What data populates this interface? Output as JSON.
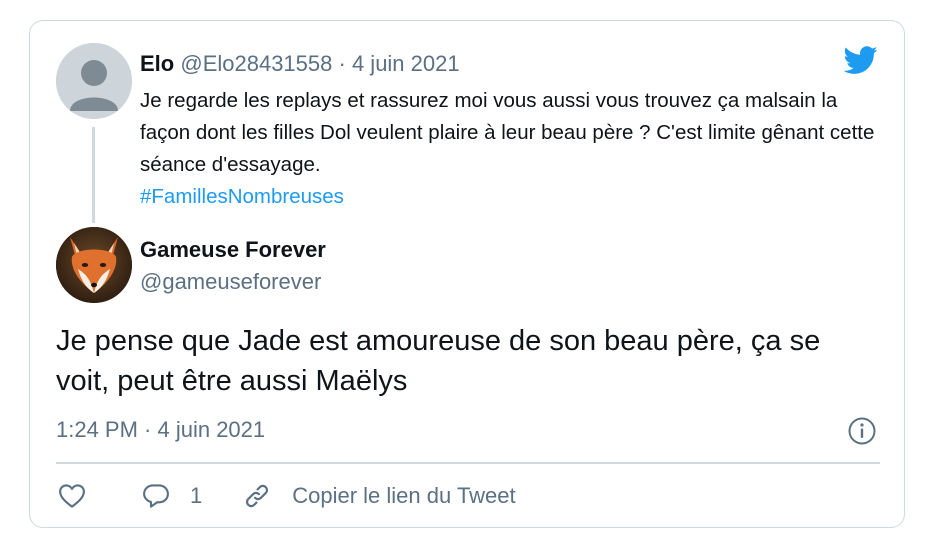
{
  "parent_tweet": {
    "author_name": "Elo",
    "author_handle": "@Elo28431558",
    "separator": "·",
    "date": "4 juin 2021",
    "text": "Je regarde les replays et rassurez moi vous aussi vous trouvez ça malsain la façon dont les filles Dol veulent plaire à leur beau père ? C'est limite gênant cette séance d'essayage.",
    "hashtag": "#FamillesNombreuses"
  },
  "main_tweet": {
    "author_name": "Gameuse Forever",
    "author_handle": "@gameuseforever",
    "text": "Je pense que Jade est amoureuse de son beau père, ça se voit, peut être aussi Maëlys",
    "timestamp": "1:24 PM · 4 juin 2021"
  },
  "actions": {
    "reply_count": "1",
    "copy_link_label": "Copier le lien du Tweet"
  },
  "icons": {
    "brand": "twitter-bird-icon",
    "info": "info-icon",
    "like": "heart-icon",
    "reply": "speech-bubble-icon",
    "copy": "link-icon"
  },
  "colors": {
    "brand_blue": "#1d9bf0",
    "text_primary": "#0f1419",
    "text_secondary": "#5b7083",
    "border": "#cfd9de"
  }
}
